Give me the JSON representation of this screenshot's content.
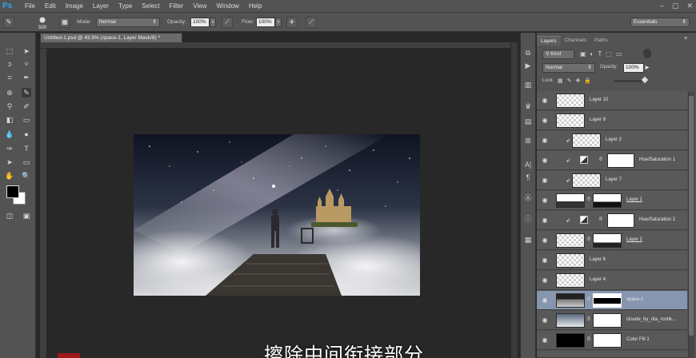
{
  "menubar": {
    "logo": "Ps",
    "items": [
      "File",
      "Edit",
      "Image",
      "Layer",
      "Type",
      "Select",
      "Filter",
      "View",
      "Window",
      "Help"
    ],
    "window_controls": [
      "–",
      "▢",
      "✕"
    ]
  },
  "options": {
    "brush_size": "500",
    "mode_label": "Mode:",
    "mode_value": "Normal",
    "opacity_label": "Opacity:",
    "opacity_value": "100%",
    "flow_label": "Flow:",
    "flow_value": "100%",
    "workspace": "Essentials"
  },
  "document": {
    "tab_title": "Untitled-1.psd @ 43.9% (space-1, Layer Mask/8) *",
    "subtitle": "擦除中间衔接部分"
  },
  "layers_panel": {
    "tabs": [
      "Layers",
      "Channels",
      "Paths"
    ],
    "kind_label": "Kind",
    "blend_mode": "Normal",
    "opacity_label": "Opacity:",
    "opacity_value": "100%",
    "lock_label": "Lock:",
    "layers": [
      {
        "name": "Layer 10"
      },
      {
        "name": "Layer 8"
      },
      {
        "name": "Layer 2"
      },
      {
        "name": "Hue/Saturation 1"
      },
      {
        "name": "Layer 7"
      },
      {
        "name": "Layer 1"
      },
      {
        "name": "Hue/Saturation 2"
      },
      {
        "name": "Layer 2"
      },
      {
        "name": "Layer 6"
      },
      {
        "name": "Layer 4"
      },
      {
        "name": "space-1"
      },
      {
        "name": "cloude_by_rita_roshk..."
      },
      {
        "name": "Color Fill 1"
      }
    ]
  },
  "colors": {
    "ui_dark": "#535353",
    "canvas_bg": "#282828",
    "selected_layer": "#8696b0",
    "ps_blue": "#34a3f3"
  }
}
